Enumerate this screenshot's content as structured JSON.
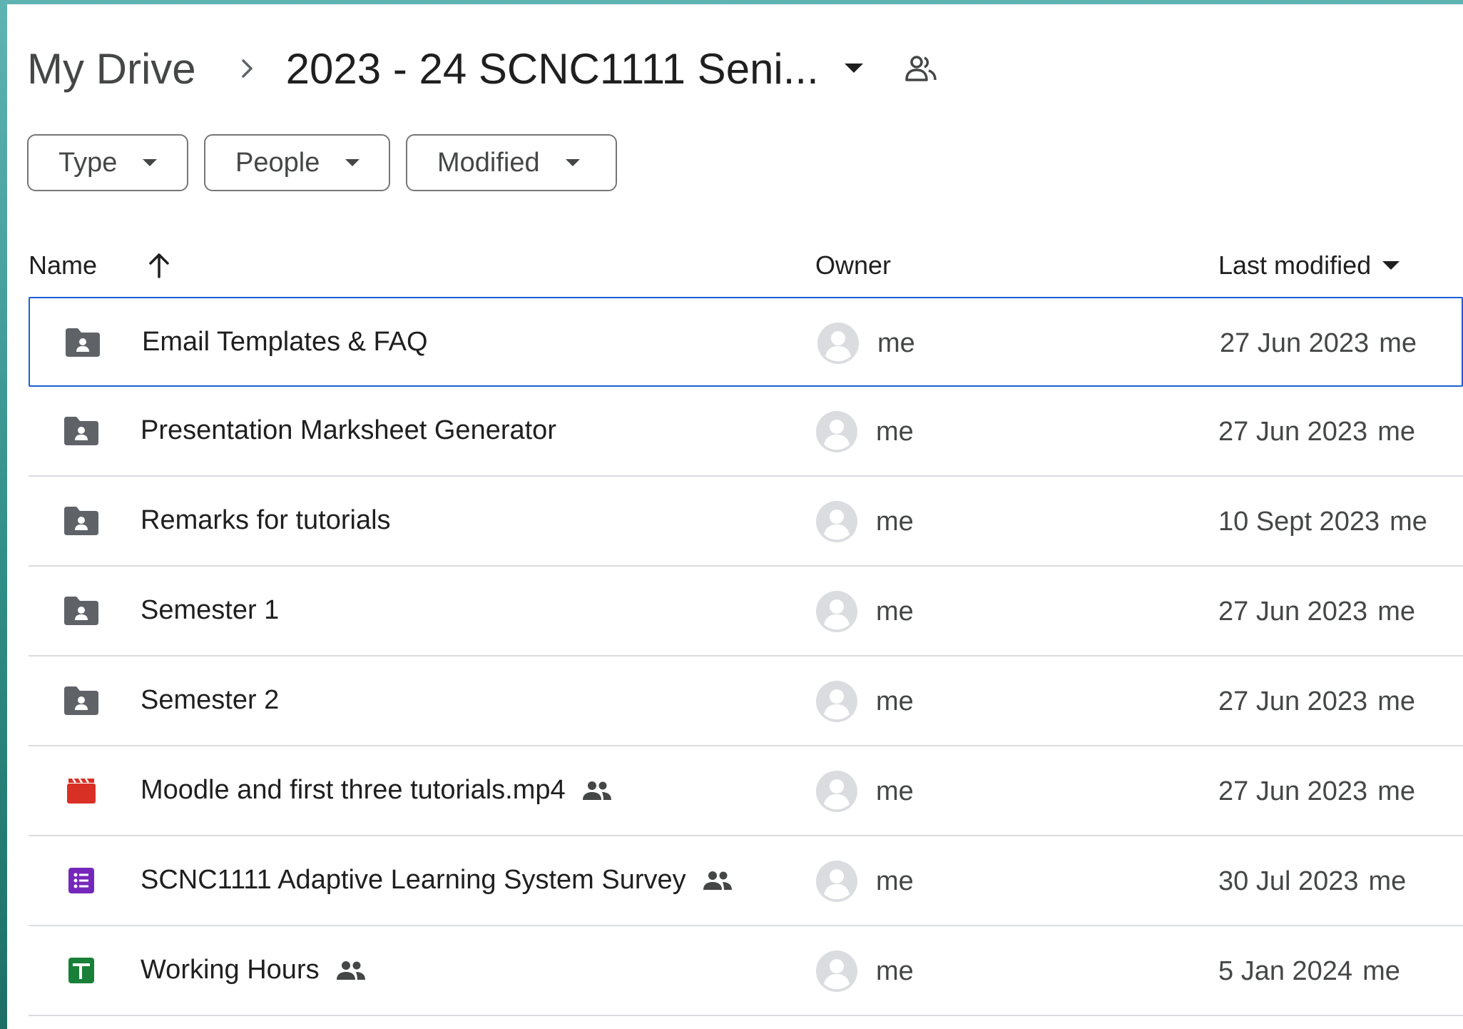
{
  "breadcrumb": {
    "root": "My Drive",
    "current": "2023 - 24 SCNC1111 Seni..."
  },
  "filters": [
    {
      "label": "Type"
    },
    {
      "label": "People"
    },
    {
      "label": "Modified"
    }
  ],
  "columns": {
    "name": "Name",
    "owner": "Owner",
    "last_modified": "Last modified"
  },
  "files": [
    {
      "name": "Email Templates & FAQ",
      "icon": "shared-folder-icon",
      "shared": false,
      "owner": "me",
      "date": "27 Jun 2023",
      "modified_by": "me"
    },
    {
      "name": "Presentation Marksheet Generator",
      "icon": "shared-folder-icon",
      "shared": false,
      "owner": "me",
      "date": "27 Jun 2023",
      "modified_by": "me"
    },
    {
      "name": "Remarks for tutorials",
      "icon": "shared-folder-icon",
      "shared": false,
      "owner": "me",
      "date": "10 Sept 2023",
      "modified_by": "me"
    },
    {
      "name": "Semester 1",
      "icon": "shared-folder-icon",
      "shared": false,
      "owner": "me",
      "date": "27 Jun 2023",
      "modified_by": "me"
    },
    {
      "name": "Semester 2",
      "icon": "shared-folder-icon",
      "shared": false,
      "owner": "me",
      "date": "27 Jun 2023",
      "modified_by": "me"
    },
    {
      "name": "Moodle and first three tutorials.mp4",
      "icon": "video-file-icon",
      "shared": true,
      "owner": "me",
      "date": "27 Jun 2023",
      "modified_by": "me"
    },
    {
      "name": "SCNC1111 Adaptive Learning System Survey",
      "icon": "forms-file-icon",
      "shared": true,
      "owner": "me",
      "date": "30 Jul 2023",
      "modified_by": "me"
    },
    {
      "name": "Working Hours",
      "icon": "sheets-file-icon",
      "shared": true,
      "owner": "me",
      "date": "5 Jan 2024",
      "modified_by": "me"
    }
  ],
  "colors": {
    "folder": "#5f6368",
    "video": "#d93025",
    "forms": "#7627bb",
    "sheets": "#188038",
    "selection": "#1a5fd6"
  }
}
